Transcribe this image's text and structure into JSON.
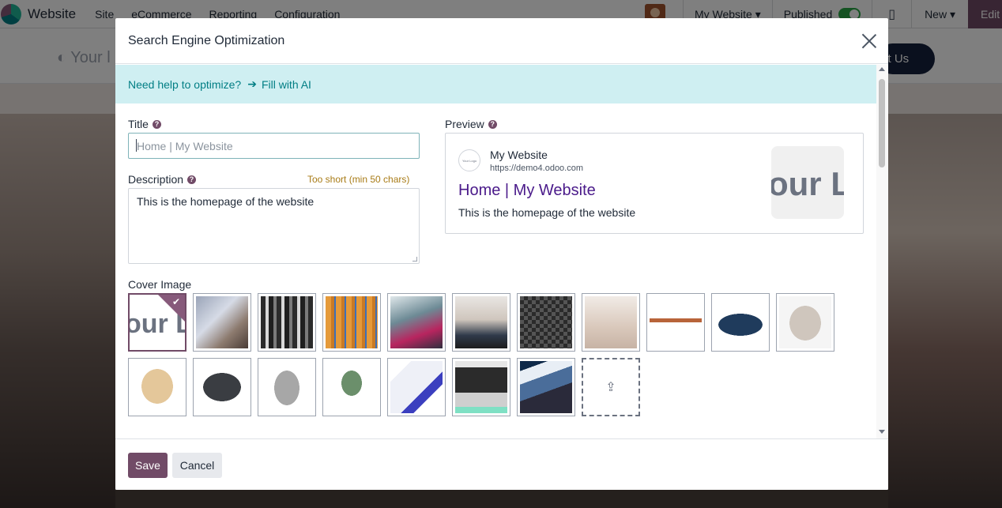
{
  "navbar": {
    "app_name": "Website",
    "menus": [
      "Site",
      "eCommerce",
      "Reporting",
      "Configuration"
    ],
    "website_selector": "My Website",
    "published_label": "Published",
    "new_label": "New",
    "edit_label": "Edit"
  },
  "site_header": {
    "logo_text": "Your l",
    "contact_label": "ct Us"
  },
  "modal": {
    "title": "Search Engine Optimization",
    "ai_banner": {
      "question": "Need help to optimize?",
      "arrow": "➔",
      "link": "Fill with AI"
    },
    "title_field": {
      "label": "Title",
      "placeholder": "Home | My Website",
      "value": ""
    },
    "description_field": {
      "label": "Description",
      "warning": "Too short (min 50 chars)",
      "value": "This is the homepage of the website"
    },
    "preview": {
      "label": "Preview",
      "favicon_text": "Your Logo",
      "site_name": "My Website",
      "url": "https://demo4.odoo.com",
      "page_title": "Home | My Website",
      "description": "This is the homepage of the website",
      "thumb_text": "our L"
    },
    "cover_image": {
      "label": "Cover Image",
      "selected_logo_text": "our L",
      "images": [
        {
          "name": "logo",
          "selected": true
        },
        {
          "name": "dress-detail"
        },
        {
          "name": "clothing-rack-dark"
        },
        {
          "name": "hangers-orange"
        },
        {
          "name": "clothes-rack-colorful"
        },
        {
          "name": "woman-sitting"
        },
        {
          "name": "checkered-bag"
        },
        {
          "name": "boutique-interior"
        },
        {
          "name": "wooden-table"
        },
        {
          "name": "blue-sofa"
        },
        {
          "name": "storage-box"
        },
        {
          "name": "wooden-cabinet"
        },
        {
          "name": "black-dresser"
        },
        {
          "name": "metal-bin"
        },
        {
          "name": "green-lamp"
        },
        {
          "name": "software-box"
        },
        {
          "name": "store-rack"
        },
        {
          "name": "clothes-rack-blue"
        }
      ],
      "upload_icon": "upload-icon"
    },
    "footer": {
      "save_label": "Save",
      "cancel_label": "Cancel"
    }
  },
  "colors": {
    "primary": "#714b67",
    "ai_banner_bg": "#cfeff2",
    "ai_banner_text": "#017e84",
    "warning_text": "#a87b16",
    "preview_title": "#4a1a8a",
    "toggle_on": "#28a745"
  }
}
